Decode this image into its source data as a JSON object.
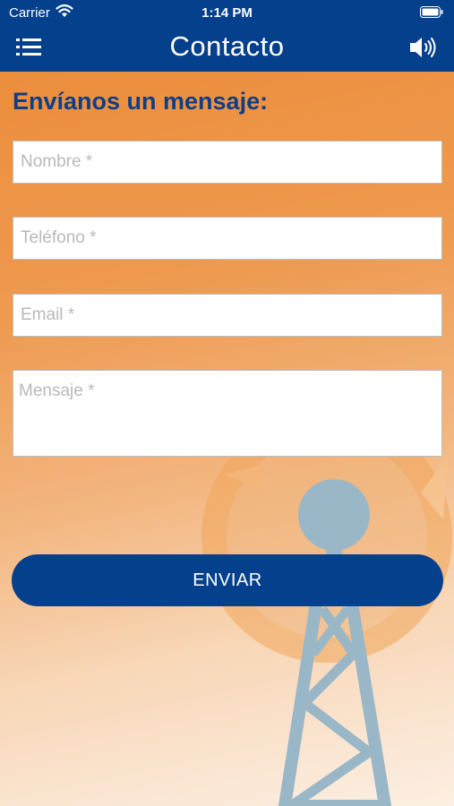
{
  "status_bar": {
    "carrier": "Carrier",
    "time": "1:14 PM"
  },
  "nav": {
    "title": "Contacto",
    "menu_icon": "hamburger-menu-icon",
    "sound_icon": "speaker-icon"
  },
  "form": {
    "heading": "Envíanos un mensaje:",
    "nombre_placeholder": "Nombre *",
    "telefono_placeholder": "Teléfono *",
    "email_placeholder": "Email *",
    "mensaje_placeholder": "Mensaje *",
    "submit_label": "ENVIAR"
  },
  "colors": {
    "primary": "#05408c",
    "heading": "#0e3f86",
    "background_top": "#ec8e3c",
    "background_bottom": "#fcefe3",
    "tower": "#9ab7c8"
  }
}
